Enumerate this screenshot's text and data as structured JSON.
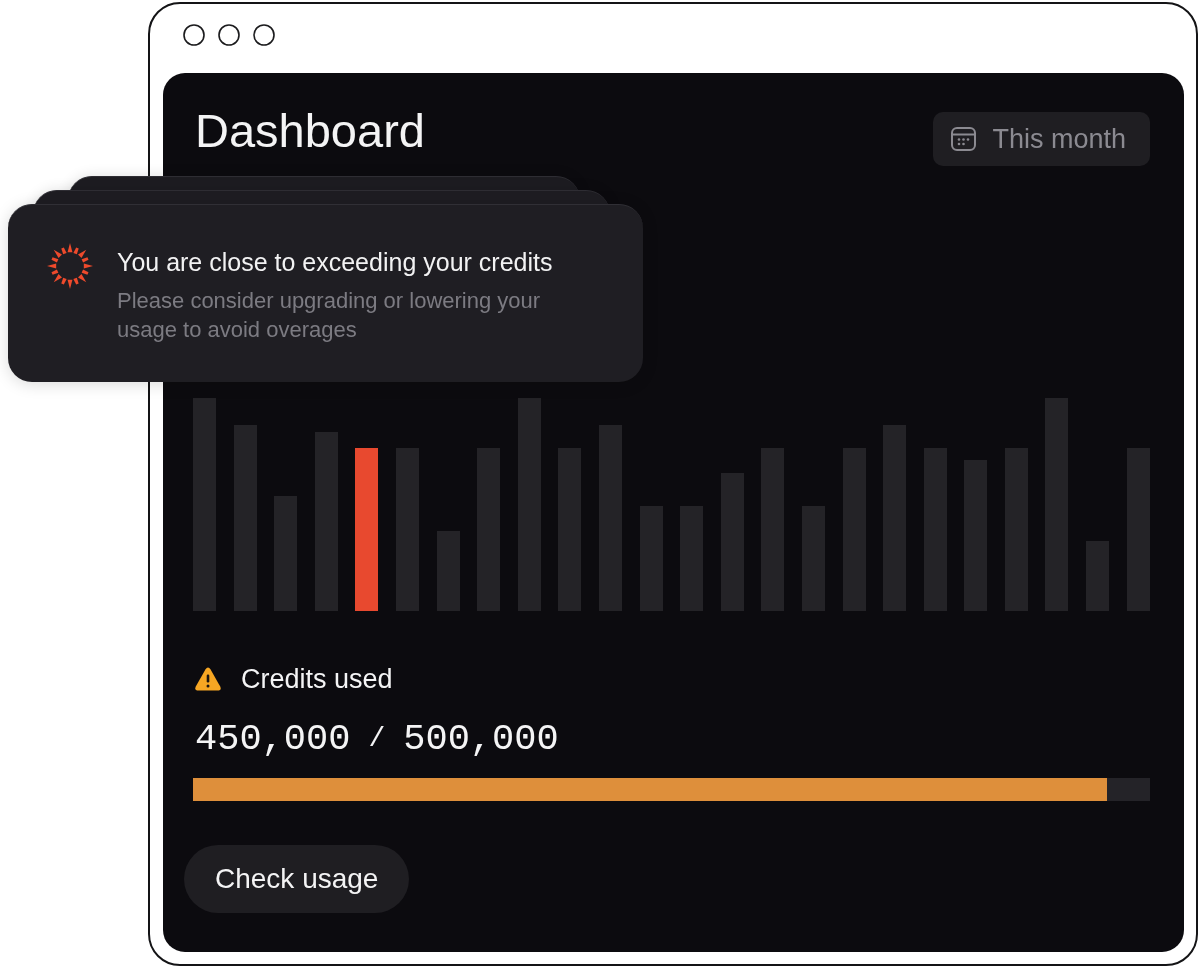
{
  "dashboard": {
    "title": "Dashboard",
    "period_button": {
      "label": "This month"
    }
  },
  "notification": {
    "title": "You are close to exceeding your credits",
    "message": "Please consider upgrading or lowering your usage to avoid overages"
  },
  "credits": {
    "label": "Credits used",
    "used": "450,000",
    "separator": "/",
    "total": "500,000",
    "level": 0.955
  },
  "action_button": {
    "label": "Check usage"
  }
}
